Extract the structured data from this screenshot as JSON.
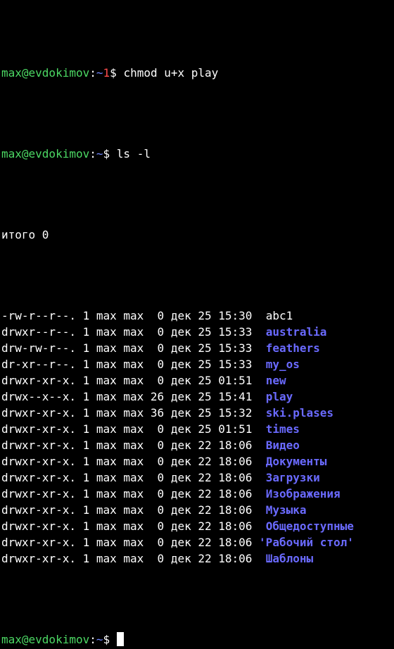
{
  "colors": {
    "background": "#000000",
    "text": "#ffffff",
    "prompt_user": "#4cd964",
    "prompt_path": "#6f86ff",
    "exit_code": "#ff4d4d",
    "directory": "#6a6aff"
  },
  "prompt": {
    "user_host": "max@evdokimov",
    "sep": ":",
    "path": "~",
    "exit_code": "1",
    "symbol": "$"
  },
  "commands": [
    "chmod u+x play",
    "ls -l"
  ],
  "total_line": "итого 0",
  "entries": [
    {
      "perms": "-rw-r--r--.",
      "links": "1",
      "owner": "max",
      "group": "max",
      "size": " 0",
      "month": "дек",
      "day": "25",
      "time": "15:30",
      "name": "abc1",
      "is_dir": false
    },
    {
      "perms": "drwxr--r--.",
      "links": "1",
      "owner": "max",
      "group": "max",
      "size": " 0",
      "month": "дек",
      "day": "25",
      "time": "15:33",
      "name": "australia",
      "is_dir": true
    },
    {
      "perms": "drw-rw-r--.",
      "links": "1",
      "owner": "max",
      "group": "max",
      "size": " 0",
      "month": "дек",
      "day": "25",
      "time": "15:33",
      "name": "feathers",
      "is_dir": true
    },
    {
      "perms": "dr-xr--r--.",
      "links": "1",
      "owner": "max",
      "group": "max",
      "size": " 0",
      "month": "дек",
      "day": "25",
      "time": "15:33",
      "name": "my_os",
      "is_dir": true
    },
    {
      "perms": "drwxr-xr-x.",
      "links": "1",
      "owner": "max",
      "group": "max",
      "size": " 0",
      "month": "дек",
      "day": "25",
      "time": "01:51",
      "name": "new",
      "is_dir": true
    },
    {
      "perms": "drwx--x--x.",
      "links": "1",
      "owner": "max",
      "group": "max",
      "size": "26",
      "month": "дек",
      "day": "25",
      "time": "15:41",
      "name": "play",
      "is_dir": true
    },
    {
      "perms": "drwxr-xr-x.",
      "links": "1",
      "owner": "max",
      "group": "max",
      "size": "36",
      "month": "дек",
      "day": "25",
      "time": "15:32",
      "name": "ski.plases",
      "is_dir": true
    },
    {
      "perms": "drwxr-xr-x.",
      "links": "1",
      "owner": "max",
      "group": "max",
      "size": " 0",
      "month": "дек",
      "day": "25",
      "time": "01:51",
      "name": "times",
      "is_dir": true
    },
    {
      "perms": "drwxr-xr-x.",
      "links": "1",
      "owner": "max",
      "group": "max",
      "size": " 0",
      "month": "дек",
      "day": "22",
      "time": "18:06",
      "name": "Видео",
      "is_dir": true
    },
    {
      "perms": "drwxr-xr-x.",
      "links": "1",
      "owner": "max",
      "group": "max",
      "size": " 0",
      "month": "дек",
      "day": "22",
      "time": "18:06",
      "name": "Документы",
      "is_dir": true
    },
    {
      "perms": "drwxr-xr-x.",
      "links": "1",
      "owner": "max",
      "group": "max",
      "size": " 0",
      "month": "дек",
      "day": "22",
      "time": "18:06",
      "name": "Загрузки",
      "is_dir": true
    },
    {
      "perms": "drwxr-xr-x.",
      "links": "1",
      "owner": "max",
      "group": "max",
      "size": " 0",
      "month": "дек",
      "day": "22",
      "time": "18:06",
      "name": "Изображения",
      "is_dir": true
    },
    {
      "perms": "drwxr-xr-x.",
      "links": "1",
      "owner": "max",
      "group": "max",
      "size": " 0",
      "month": "дек",
      "day": "22",
      "time": "18:06",
      "name": "Музыка",
      "is_dir": true
    },
    {
      "perms": "drwxr-xr-x.",
      "links": "1",
      "owner": "max",
      "group": "max",
      "size": " 0",
      "month": "дек",
      "day": "22",
      "time": "18:06",
      "name": "Общедоступные",
      "is_dir": true
    },
    {
      "perms": "drwxr-xr-x.",
      "links": "1",
      "owner": "max",
      "group": "max",
      "size": " 0",
      "month": "дек",
      "day": "22",
      "time": "18:06",
      "name": "'Рабочий стол'",
      "is_dir": true,
      "quoted": true
    },
    {
      "perms": "drwxr-xr-x.",
      "links": "1",
      "owner": "max",
      "group": "max",
      "size": " 0",
      "month": "дек",
      "day": "22",
      "time": "18:06",
      "name": "Шаблоны",
      "is_dir": true
    }
  ]
}
